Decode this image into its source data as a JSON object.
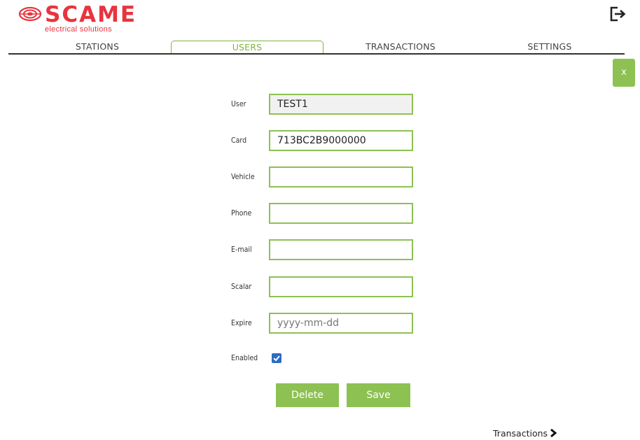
{
  "brand": {
    "name": "SCAME",
    "tagline": "electrical solutions",
    "color": "#e8343e",
    "accent": "#8dc152"
  },
  "header": {
    "logout_icon": "logout-icon"
  },
  "nav": {
    "tabs": [
      {
        "label": "STATIONS",
        "active": false
      },
      {
        "label": "USERS",
        "active": true
      },
      {
        "label": "TRANSACTIONS",
        "active": false
      },
      {
        "label": "SETTINGS",
        "active": false
      }
    ]
  },
  "close_button": {
    "label": "x"
  },
  "form": {
    "user": {
      "label": "User",
      "value": "TEST1",
      "readonly": true
    },
    "card": {
      "label": "Card",
      "value": "713BC2B9000000"
    },
    "vehicle": {
      "label": "Vehicle",
      "value": ""
    },
    "phone": {
      "label": "Phone",
      "value": ""
    },
    "email": {
      "label": "E-mail",
      "value": ""
    },
    "scalar": {
      "label": "Scalar",
      "value": ""
    },
    "expire": {
      "label": "Expire",
      "value": "",
      "placeholder": "yyyy-mm-dd"
    },
    "enabled": {
      "label": "Enabled",
      "checked": true
    }
  },
  "actions": {
    "delete_label": "Delete",
    "save_label": "Save"
  },
  "footer": {
    "transactions_link": "Transactions"
  }
}
